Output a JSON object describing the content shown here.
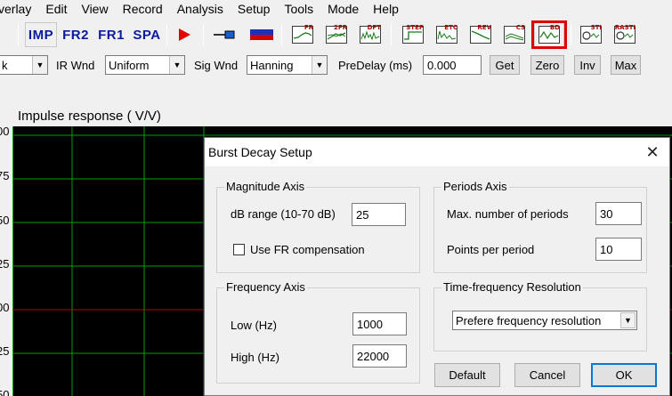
{
  "menu": [
    "verlay",
    "Edit",
    "View",
    "Record",
    "Analysis",
    "Setup",
    "Tools",
    "Mode",
    "Help"
  ],
  "toolbar": {
    "imp": "IMP",
    "fr2": "FR2",
    "fr1": "FR1",
    "spa": "SPA",
    "mini": [
      {
        "label": "FR",
        "icon": "fr-graph-icon"
      },
      {
        "label": "2FR",
        "icon": "two-fr-graph-icon"
      },
      {
        "label": "DFT",
        "icon": "dft-graph-icon"
      },
      {
        "label": "STEP",
        "icon": "step-graph-icon"
      },
      {
        "label": "ETC",
        "icon": "etc-graph-icon"
      },
      {
        "label": "REV",
        "icon": "rev-graph-icon"
      },
      {
        "label": "CS",
        "icon": "cs-graph-icon"
      },
      {
        "label": "BD",
        "icon": "burst-decay-icon"
      },
      {
        "label": "STI",
        "icon": "sti-icon"
      },
      {
        "label": "RASTI",
        "icon": "rasti-icon"
      }
    ],
    "highlight_color": "#e00000"
  },
  "controls": {
    "first_select": "k",
    "ir_wnd_label": "IR Wnd",
    "ir_wnd_value": "Uniform",
    "sig_wnd_label": "Sig Wnd",
    "sig_wnd_value": "Hanning",
    "predelay_label": "PreDelay (ms)",
    "predelay_value": "0.000",
    "get": "Get",
    "zero": "Zero",
    "inv": "Inv",
    "max": "Max"
  },
  "plot": {
    "title": "Impulse response ( V/V)",
    "y_labels": [
      "00",
      "75",
      "50",
      "25",
      "00",
      "25",
      "50"
    ],
    "grid_color": "#00a000",
    "zero_line_color": "#c00000",
    "background": "#000000"
  },
  "dialog": {
    "title": "Burst Decay Setup",
    "magnitude": {
      "title": "Magnitude Axis",
      "db_range_label": "dB range (10-70 dB)",
      "db_range_value": "25",
      "fr_comp_label": "Use FR compensation"
    },
    "periods": {
      "title": "Periods Axis",
      "max_periods_label": "Max. number of periods",
      "max_periods_value": "30",
      "points_label": "Points per period",
      "points_value": "10"
    },
    "frequency": {
      "title": "Frequency Axis",
      "low_label": "Low (Hz)",
      "low_value": "1000",
      "high_label": "High (Hz)",
      "high_value": "22000"
    },
    "tf": {
      "title": "Time-frequency Resolution",
      "value": "Prefere frequency resolution"
    },
    "buttons": {
      "default": "Default",
      "cancel": "Cancel",
      "ok": "OK"
    }
  }
}
